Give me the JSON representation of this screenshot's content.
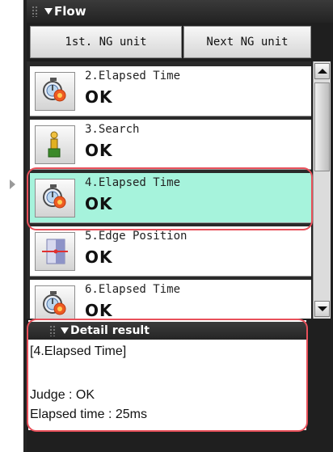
{
  "panel": {
    "title": "Flow"
  },
  "nav": {
    "first_ng": "1st. NG unit",
    "next_ng": "Next NG unit"
  },
  "flow_items": [
    {
      "name": "2.Elapsed Time",
      "status": "OK",
      "icon": "stopwatch-icon"
    },
    {
      "name": "3.Search",
      "status": "OK",
      "icon": "search-figure-icon"
    },
    {
      "name": "4.Elapsed Time",
      "status": "OK",
      "icon": "stopwatch-icon",
      "selected": true
    },
    {
      "name": "5.Edge Position",
      "status": "OK",
      "icon": "edge-position-icon"
    },
    {
      "name": "6.Elapsed Time",
      "status": "OK",
      "icon": "stopwatch-icon"
    }
  ],
  "detail": {
    "title": "Detail result",
    "unit": "[4.Elapsed Time]",
    "judge": "Judge : OK",
    "elapsed": "Elapsed time : 25ms"
  },
  "colors": {
    "selected_bg": "#a6f3dc",
    "highlight_outline": "#e8505a"
  }
}
